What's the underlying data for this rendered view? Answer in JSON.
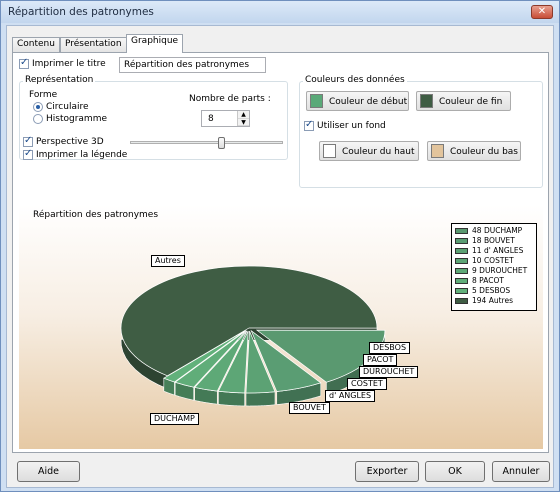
{
  "window": {
    "title": "Répartition des patronymes",
    "close_label": "✕"
  },
  "tabs": [
    {
      "label": "Contenu",
      "active": false
    },
    {
      "label": "Présentation",
      "active": false
    },
    {
      "label": "Graphique",
      "active": true
    }
  ],
  "print_title": {
    "label": "Imprimer le titre",
    "checked": true,
    "value": "Répartition des patronymes"
  },
  "representation": {
    "group_title": "Représentation",
    "forme_label": "Forme",
    "circulaire_label": "Circulaire",
    "histogramme_label": "Histogramme",
    "selected": "Circulaire",
    "nombre_parts_label": "Nombre de parts :",
    "nombre_parts_value": "8",
    "perspective_label": "Perspective 3D",
    "perspective_checked": true,
    "legend_label": "Imprimer la légende",
    "legend_checked": true,
    "perspective_level": 0.6
  },
  "colors": {
    "group_title": "Couleurs des données",
    "debut_label": "Couleur de début",
    "debut_color": "#5aa978",
    "fin_label": "Couleur de fin",
    "fin_color": "#3e5c43",
    "use_background_label": "Utiliser un fond",
    "use_background_checked": true,
    "haut_label": "Couleur du haut",
    "haut_color": "#ffffff",
    "bas_label": "Couleur du bas",
    "bas_color": "#e2c49c"
  },
  "chart_data": {
    "type": "pie",
    "title": "Répartition des patronymes",
    "perspective_3d": true,
    "slices": [
      {
        "label": "Autres",
        "value": 194,
        "color": "#3f5d44"
      },
      {
        "label": "DUCHAMP",
        "value": 48,
        "color": "#5a9970"
      },
      {
        "label": "BOUVET",
        "value": 18,
        "color": "#5a9d73"
      },
      {
        "label": "d' ANGLES",
        "value": 11,
        "color": "#5ca274"
      },
      {
        "label": "COSTET",
        "value": 10,
        "color": "#5da676"
      },
      {
        "label": "DUROUCHET",
        "value": 9,
        "color": "#5ea977"
      },
      {
        "label": "PACOT",
        "value": 8,
        "color": "#60ad79"
      },
      {
        "label": "DESBOS",
        "value": 5,
        "color": "#62b17b"
      }
    ],
    "legend": [
      {
        "count": "48",
        "name": "DUCHAMP",
        "color": "#5a9970"
      },
      {
        "count": "18",
        "name": "BOUVET",
        "color": "#5a9d73"
      },
      {
        "count": "11",
        "name": "d' ANGLES",
        "color": "#5ca274"
      },
      {
        "count": "10",
        "name": "COSTET",
        "color": "#5da676"
      },
      {
        "count": "9",
        "name": "DUROUCHET",
        "color": "#5ea977"
      },
      {
        "count": "8",
        "name": "PACOT",
        "color": "#60ad79"
      },
      {
        "count": "5",
        "name": "DESBOS",
        "color": "#62b17b"
      },
      {
        "count": "194",
        "name": "Autres",
        "color": "#3f5d44"
      }
    ]
  },
  "buttons": {
    "aide": "Aide",
    "exporter": "Exporter",
    "ok": "OK",
    "annuler": "Annuler"
  }
}
